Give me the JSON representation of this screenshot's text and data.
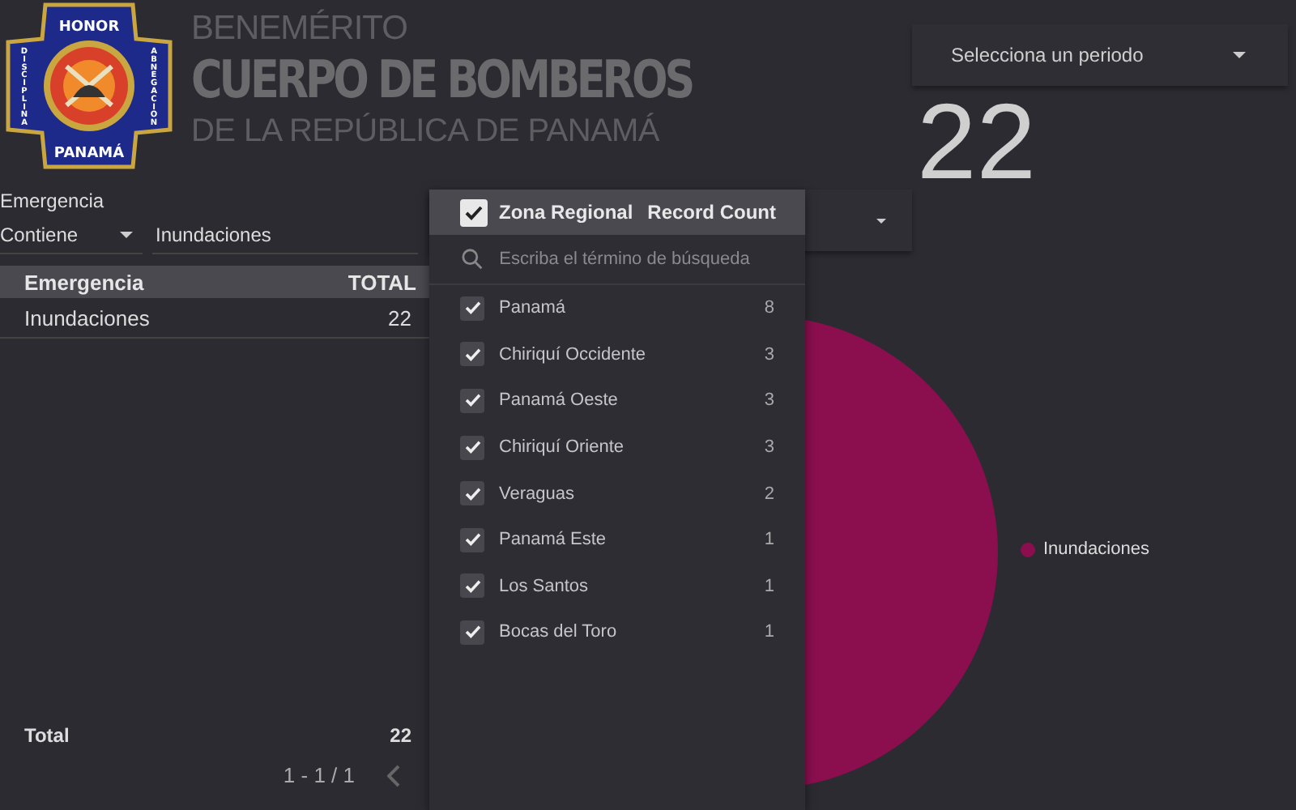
{
  "logo": {
    "top": "HONOR",
    "bottom": "PANAMÁ",
    "left": "DISCIPLINA",
    "right": "ABNEGACION"
  },
  "header": {
    "line_1": "BENEMÉRITO",
    "line_2": "CUERPO DE BOMBEROS",
    "line_3": "DE LA REPÚBLICA DE PANAMÁ"
  },
  "period_select": {
    "placeholder": "Selecciona un periodo"
  },
  "scorecard": {
    "value": "22"
  },
  "filter": {
    "label": "Emergencia",
    "operator": "Contiene",
    "value": "Inundaciones"
  },
  "table": {
    "columns": [
      "Emergencia",
      "TOTAL"
    ],
    "rows": [
      [
        "Inundaciones",
        "22"
      ]
    ],
    "total": [
      "Total",
      "22"
    ],
    "pagination": "1 - 1 / 1"
  },
  "zone_dropdown": {
    "header": {
      "checked": true,
      "label": "Zona Regional",
      "count_label": "Record Count"
    },
    "search": {
      "placeholder": "Escriba el término de búsqueda"
    },
    "items": [
      {
        "label": "Panamá",
        "count": "8",
        "checked": true
      },
      {
        "label": "Chiriquí Occidente",
        "count": "3",
        "checked": true
      },
      {
        "label": "Panamá Oeste",
        "count": "3",
        "checked": true
      },
      {
        "label": "Chiriquí Oriente",
        "count": "3",
        "checked": true
      },
      {
        "label": "Veraguas",
        "count": "2",
        "checked": true
      },
      {
        "label": "Panamá Este",
        "count": "1",
        "checked": true
      },
      {
        "label": "Los Santos",
        "count": "1",
        "checked": true
      },
      {
        "label": "Bocas del Toro",
        "count": "1",
        "checked": true
      }
    ]
  },
  "pie": {
    "legend": [
      {
        "label": "Inundaciones",
        "color": "#8b0f4f"
      }
    ]
  }
}
